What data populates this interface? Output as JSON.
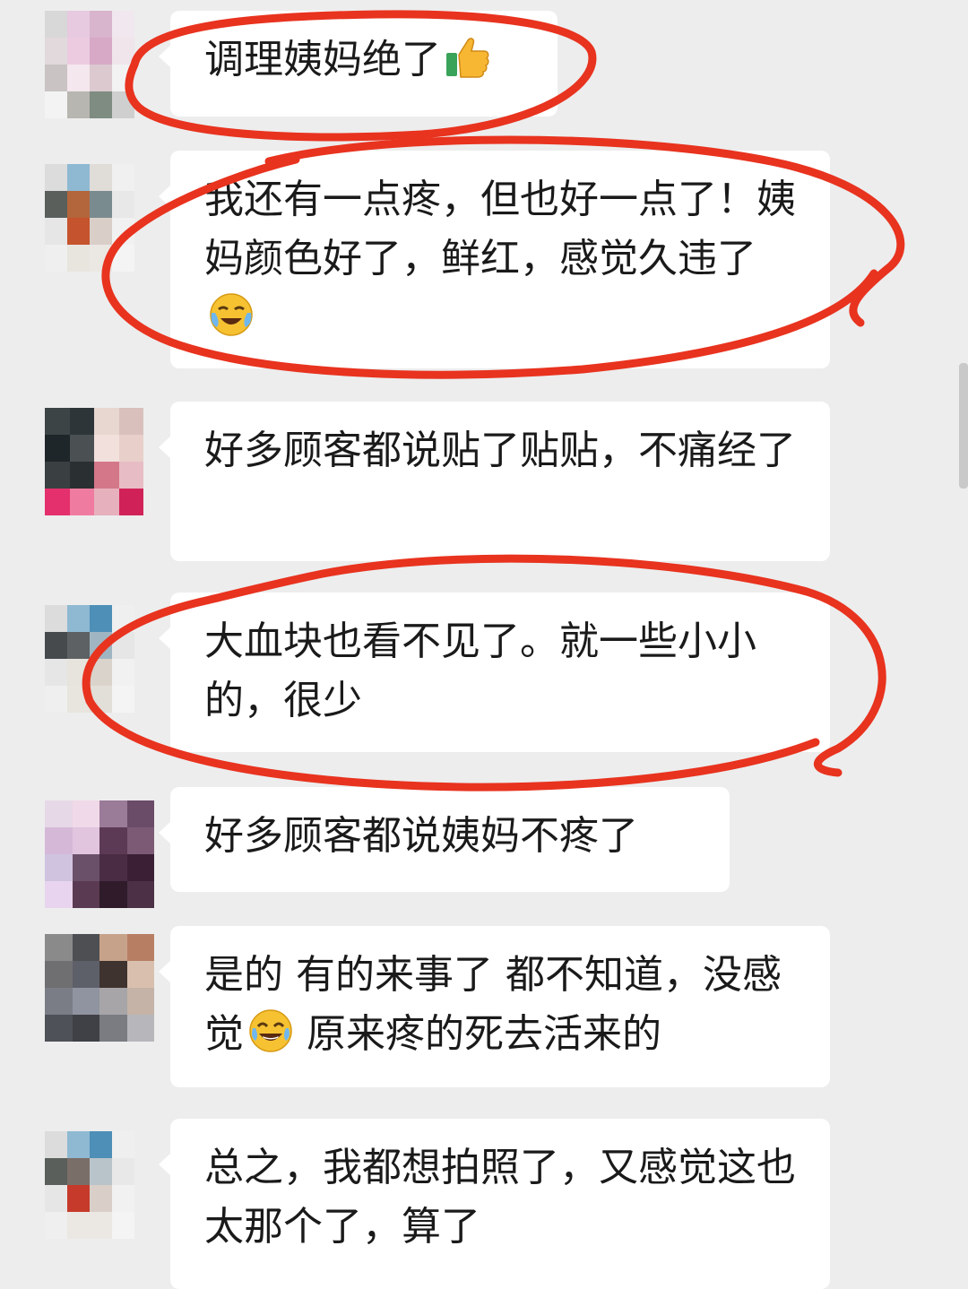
{
  "messages": [
    {
      "text": "调理姨妈绝了",
      "emoji": "thumbs-up-icon"
    },
    {
      "text": "我还有一点疼，但也好一点了！姨妈颜色好了，鲜红，感觉久违了",
      "emoji": "crying-laughing-icon"
    },
    {
      "text": "好多顾客都说贴了贴贴，不痛经了"
    },
    {
      "text": "大血块也看不见了。就一些小小的，很少"
    },
    {
      "text": "好多顾客都说姨妈不疼了"
    },
    {
      "text_before": "是的 有的来事了 都不知道，没感觉",
      "emoji": "tears-of-joy-icon",
      "text_after": " 原来疼的死去活来的"
    },
    {
      "text": "总之，我都想拍照了，又感觉这也太那个了，算了"
    }
  ],
  "annotation_color": "#e8331f",
  "bubble_color": "#ffffff",
  "background_color": "#ededed"
}
